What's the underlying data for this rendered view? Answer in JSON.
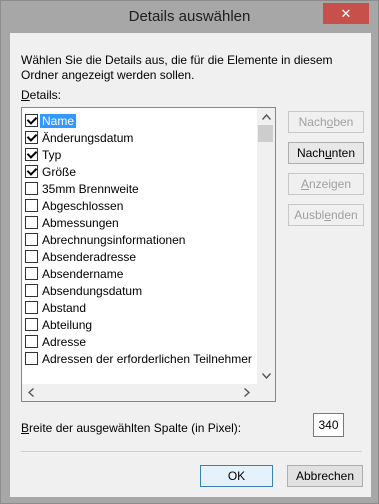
{
  "window": {
    "title": "Details auswählen",
    "close_glyph": "✕"
  },
  "description": "Wählen Sie die Details aus, die für die Elemente in diesem Ordner angezeigt werden sollen.",
  "details_label": {
    "accesskey": "D",
    "rest": "etails:"
  },
  "list": {
    "items": [
      {
        "label": "Name",
        "checked": true,
        "selected": true
      },
      {
        "label": "Änderungsdatum",
        "checked": true,
        "selected": false
      },
      {
        "label": "Typ",
        "checked": true,
        "selected": false
      },
      {
        "label": "Größe",
        "checked": true,
        "selected": false
      },
      {
        "label": "35mm Brennweite",
        "checked": false,
        "selected": false
      },
      {
        "label": "Abgeschlossen",
        "checked": false,
        "selected": false
      },
      {
        "label": "Abmessungen",
        "checked": false,
        "selected": false
      },
      {
        "label": "Abrechnungsinformationen",
        "checked": false,
        "selected": false
      },
      {
        "label": "Absenderadresse",
        "checked": false,
        "selected": false
      },
      {
        "label": "Absendername",
        "checked": false,
        "selected": false
      },
      {
        "label": "Absendungsdatum",
        "checked": false,
        "selected": false
      },
      {
        "label": "Abstand",
        "checked": false,
        "selected": false
      },
      {
        "label": "Abteilung",
        "checked": false,
        "selected": false
      },
      {
        "label": "Adresse",
        "checked": false,
        "selected": false
      },
      {
        "label": "Adressen der erforderlichen Teilnehmer",
        "checked": false,
        "selected": false
      }
    ]
  },
  "buttons": {
    "move_up": {
      "pre": "Nach ",
      "key": "o",
      "post": "ben",
      "enabled": false
    },
    "move_down": {
      "pre": "Nach ",
      "key": "u",
      "post": "nten",
      "enabled": true
    },
    "show": {
      "pre": "",
      "key": "A",
      "post": "nzeigen",
      "enabled": false
    },
    "hide": {
      "pre": "Ausbl",
      "key": "e",
      "post": "nden",
      "enabled": false
    },
    "ok": "OK",
    "cancel": "Abbrechen"
  },
  "column_width": {
    "label_key": "B",
    "label_rest": "reite der ausgewählten Spalte (in Pixel):",
    "value": "340"
  }
}
